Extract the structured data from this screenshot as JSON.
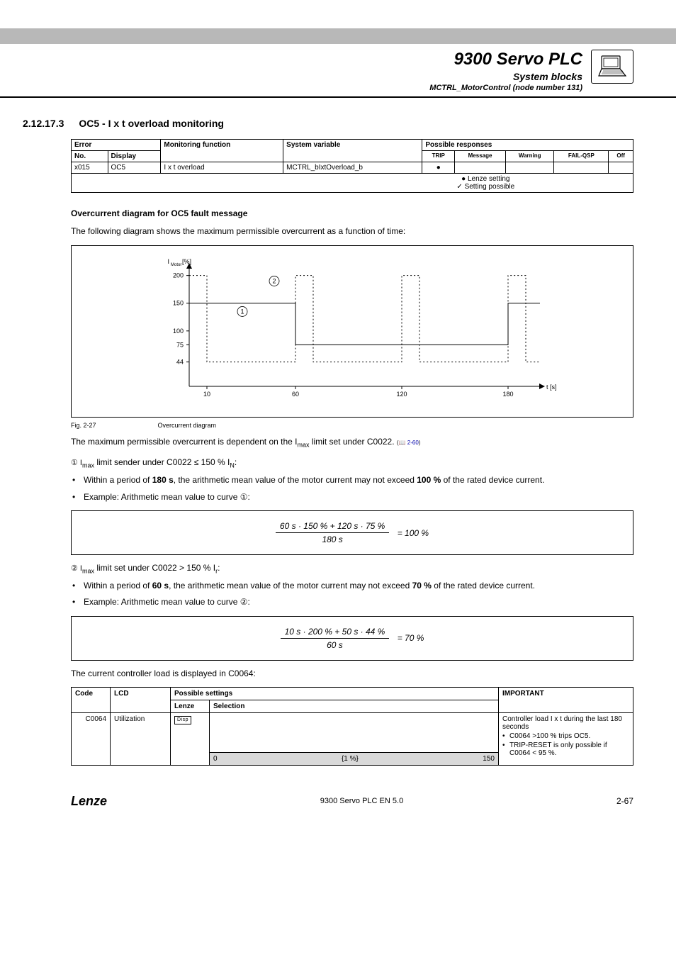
{
  "header": {
    "title": "9300 Servo PLC",
    "subtitle1": "System blocks",
    "subtitle2": "MCTRL_MotorControl (node number 131)"
  },
  "section": {
    "number": "2.12.17.3",
    "title": "OC5 - I x t overload monitoring"
  },
  "errTable": {
    "headers": {
      "error": "Error",
      "no": "No.",
      "display": "Display",
      "monfunc": "Monitoring function",
      "sysvar": "System variable",
      "possresp": "Possible responses",
      "trip": "TRIP",
      "message": "Message",
      "warning": "Warning",
      "failqsp": "FAIL-QSP",
      "off": "Off"
    },
    "row": {
      "no": "x015",
      "display": "OC5",
      "monfunc": "I x t overload",
      "sysvar": "MCTRL_bIxtOverload_b",
      "trip": "●"
    },
    "legend": {
      "lenze": "● Lenze setting",
      "possible": "✓ Setting possible"
    }
  },
  "overcurrent": {
    "heading": "Overcurrent diagram for OC5 fault message",
    "intro": "The following diagram shows the maximum permissible overcurrent as a function of time:",
    "fig_num": "Fig. 2-27",
    "fig_caption": "Overcurrent diagram"
  },
  "chart_data": {
    "type": "step-line",
    "title": "Overcurrent diagram",
    "xlabel": "t [s]",
    "ylabel": "I_Motor [%]",
    "x_ticks": [
      10,
      60,
      120,
      180
    ],
    "y_ticks": [
      44,
      75,
      100,
      150,
      200
    ],
    "xlim": [
      0,
      200
    ],
    "ylim": [
      0,
      220
    ],
    "series": [
      {
        "name": "①",
        "points": [
          {
            "x": 0,
            "y": 150
          },
          {
            "x": 60,
            "y": 150
          },
          {
            "x": 60,
            "y": 75
          },
          {
            "x": 180,
            "y": 75
          },
          {
            "x": 180,
            "y": 150
          },
          {
            "x": 198,
            "y": 150
          }
        ],
        "style": "solid"
      },
      {
        "name": "②",
        "points": [
          {
            "x": 0,
            "y": 200
          },
          {
            "x": 10,
            "y": 200
          },
          {
            "x": 10,
            "y": 44
          },
          {
            "x": 60,
            "y": 44
          },
          {
            "x": 60,
            "y": 200
          },
          {
            "x": 70,
            "y": 200
          },
          {
            "x": 70,
            "y": 44
          },
          {
            "x": 120,
            "y": 44
          },
          {
            "x": 120,
            "y": 200
          },
          {
            "x": 130,
            "y": 200
          },
          {
            "x": 130,
            "y": 44
          },
          {
            "x": 180,
            "y": 44
          },
          {
            "x": 180,
            "y": 200
          },
          {
            "x": 190,
            "y": 200
          },
          {
            "x": 190,
            "y": 44
          },
          {
            "x": 198,
            "y": 44
          }
        ],
        "style": "dashed"
      }
    ]
  },
  "after_diagram": {
    "p1_a": "The maximum permissible overcurrent is dependent on the I",
    "p1_b": " limit set under C0022. ",
    "p1_link_icon": "📖",
    "p1_link": "2-60",
    "case1_lead": "① I",
    "case1_rest": " limit sender under C0022 ≤ 150 % I",
    "case1_tail": ":",
    "case1_b1_a": "Within a period of ",
    "case1_b1_b": "180 s",
    "case1_b1_c": ", the arithmetic mean value of the motor current may not exceed ",
    "case1_b1_d": "100 %",
    "case1_b1_e": " of the rated device current.",
    "case1_b2": "Example: Arithmetic mean value to curve ①:",
    "eq1_num": "60 s · 150 % + 120 s · 75 %",
    "eq1_den": "180 s",
    "eq1_rhs": "= 100 %",
    "case2_lead": "② I",
    "case2_rest": " limit set under C0022 > 150 % I",
    "case2_tail": ":",
    "case2_b1_a": "Within a period of ",
    "case2_b1_b": "60 s",
    "case2_b1_c": ", the arithmetic mean value of the motor current may not exceed ",
    "case2_b1_d": "70 %",
    "case2_b1_e": " of the rated device current.",
    "case2_b2": "Example: Arithmetic mean value to curve ②:",
    "eq2_num": "10 s · 200 % + 50 s · 44 %",
    "eq2_den": "60 s",
    "eq2_rhs": "= 70 %",
    "load_p": "The current controller load is displayed in C0064:"
  },
  "codeTable": {
    "headers": {
      "code": "Code",
      "lcd": "LCD",
      "possible": "Possible settings",
      "lenze": "Lenze",
      "selection": "Selection",
      "important": "IMPORTANT"
    },
    "row": {
      "code": "C0064",
      "lcd": "Utilization",
      "lenze_badge": "Disp",
      "imp_lead": "Controller load I x t during the last 180 seconds",
      "imp_b1": "C0064 >100 % trips OC5.",
      "imp_b2": "TRIP-RESET is only possible if C0064 < 95 %.",
      "range_min": "0",
      "range_step": "{1 %}",
      "range_max": "150"
    }
  },
  "footer": {
    "brand": "Lenze",
    "center": "9300 Servo PLC EN 5.0",
    "page": "2-67"
  }
}
